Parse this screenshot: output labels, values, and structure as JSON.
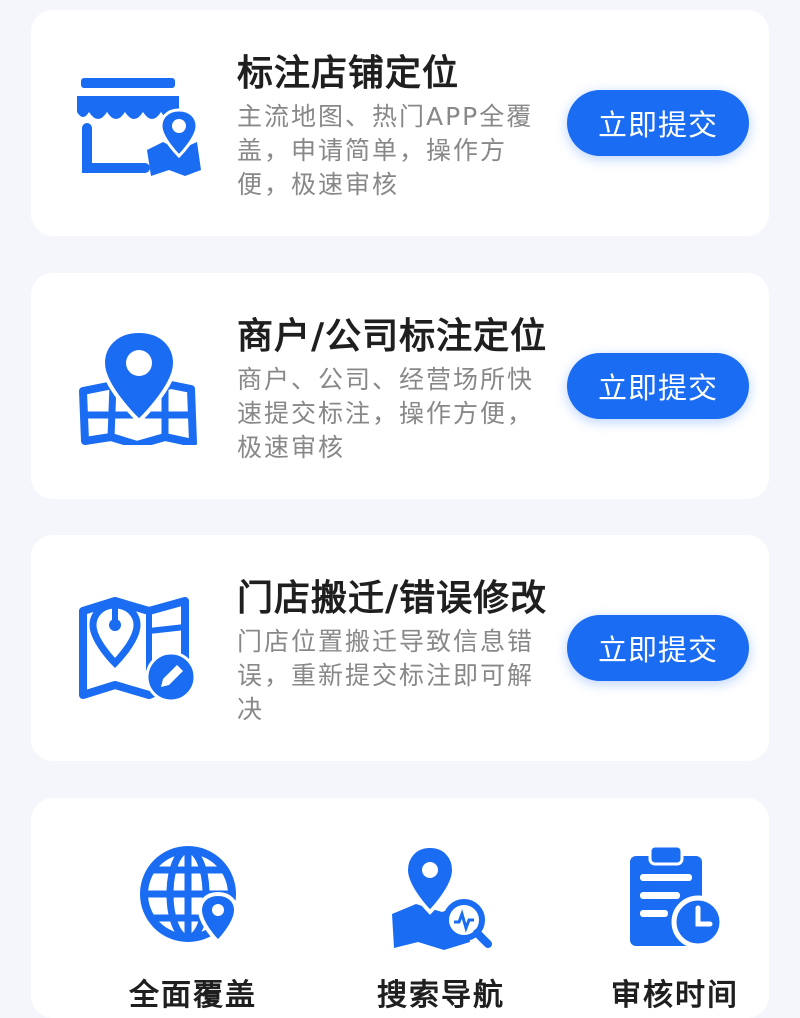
{
  "colors": {
    "accent": "#1a6cf3",
    "background": "#f4f6fb",
    "card": "#ffffff",
    "title": "#1f1f1f",
    "description": "#888888"
  },
  "services": [
    {
      "icon": "storefront-location-icon",
      "title": "标注店铺定位",
      "description": "主流地图、热门APP全覆盖，申请简单，操作方便，极速审核",
      "button_label": "立即提交"
    },
    {
      "icon": "map-pin-icon",
      "title": "商户/公司标注定位",
      "description": "商户、公司、经营场所快速提交标注，操作方便，极速审核",
      "button_label": "立即提交"
    },
    {
      "icon": "map-edit-icon",
      "title": "门店搬迁/错误修改",
      "description": "门店位置搬迁导致信息错误，重新提交标注即可解决",
      "button_label": "立即提交"
    }
  ],
  "features": [
    {
      "icon": "globe-location-icon",
      "label": "全面覆盖"
    },
    {
      "icon": "map-search-icon",
      "label": "搜索导航"
    },
    {
      "icon": "clipboard-clock-icon",
      "label": "审核时间"
    }
  ]
}
